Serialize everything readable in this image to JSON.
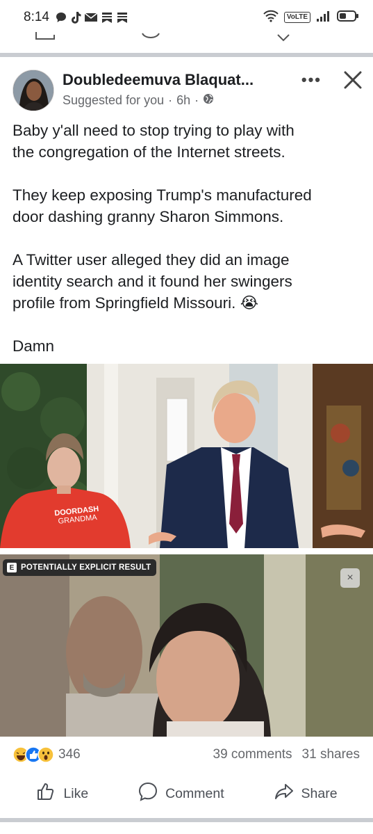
{
  "status_bar": {
    "time": "8:14",
    "volte": "VoLTE",
    "notification_icons": [
      "chat-icon",
      "tiktok-icon",
      "mail-icon",
      "news-icon",
      "news-icon"
    ],
    "right_icons": [
      "wifi-icon",
      "signal-icon",
      "battery-icon"
    ]
  },
  "post": {
    "author": "Doubledeemuva Blaquat...",
    "meta": "Suggested for you",
    "time": "6h",
    "audience_icon": "globe-icon",
    "more_label": "•••",
    "paragraphs": [
      "Baby y'all need to stop trying to play with\nthe congregation of the Internet streets.",
      "They keep exposing Trump's manufactured\ndoor dashing granny Sharon Simmons.",
      "A Twitter user alleged they did an  image\nidentity search and it found her swingers\nprofile from Springfield Missouri.",
      "Damn"
    ],
    "crying_emoji": "😭",
    "photo_top": {
      "shirt_line1": "DOORDASH",
      "shirt_line2": "GRANDMA"
    },
    "photo_bottom": {
      "badge_letter": "E",
      "badge_text": "POTENTIALLY EXPLICIT RESULT",
      "dismiss_label": "×"
    }
  },
  "engagement": {
    "reaction_icons": [
      "haha-icon",
      "like-icon",
      "wow-icon"
    ],
    "reaction_count": "346",
    "comments": "39 comments",
    "shares": "31 shares"
  },
  "actions": {
    "like": "Like",
    "comment": "Comment",
    "share": "Share"
  },
  "colors": {
    "divider": "#c9ccd1",
    "meta_gray": "#65676b",
    "like_blue": "#1877f2",
    "haha_yellow": "#f7c13b"
  }
}
